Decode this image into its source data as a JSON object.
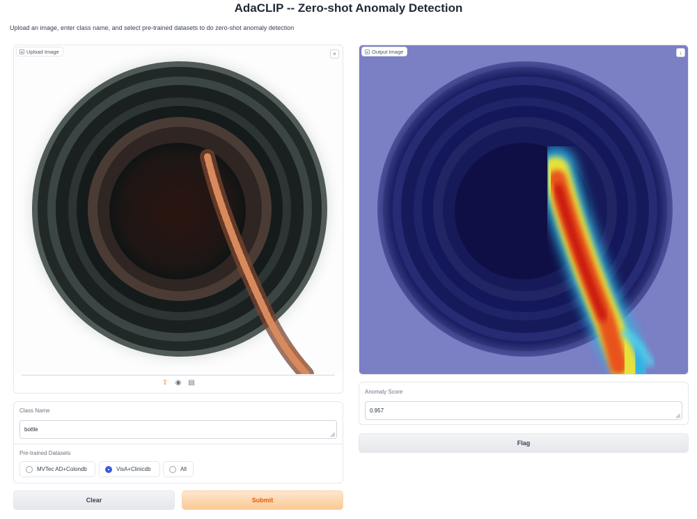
{
  "header": {
    "title": "AdaCLIP -- Zero-shot Anomaly Detection",
    "subtitle": "Upload an image, enter class name, and select pre-trained datasets to do zero-shot anomaly detection"
  },
  "upload_panel": {
    "label": "Upload Image",
    "close_glyph": "×",
    "tools": [
      "upload-icon",
      "webcam-icon",
      "clipboard-icon"
    ]
  },
  "output_panel": {
    "label": "Output Image",
    "download_glyph": "↓"
  },
  "class_name": {
    "label": "Class Name",
    "value": "bottle"
  },
  "datasets": {
    "label": "Pre-trained Datasets",
    "options": [
      "MVTec AD+Colondb",
      "VisA+Clinicdb",
      "All"
    ],
    "selected": "VisA+Clinicdb"
  },
  "anomaly_score": {
    "label": "Anomaly Score",
    "value": "0.957"
  },
  "buttons": {
    "clear": "Clear",
    "submit": "Submit",
    "flag": "Flag"
  },
  "colors": {
    "accent": "#f97316",
    "radio_selected": "#3b5bdb",
    "heatmap_bg": "#7b7fc4"
  }
}
